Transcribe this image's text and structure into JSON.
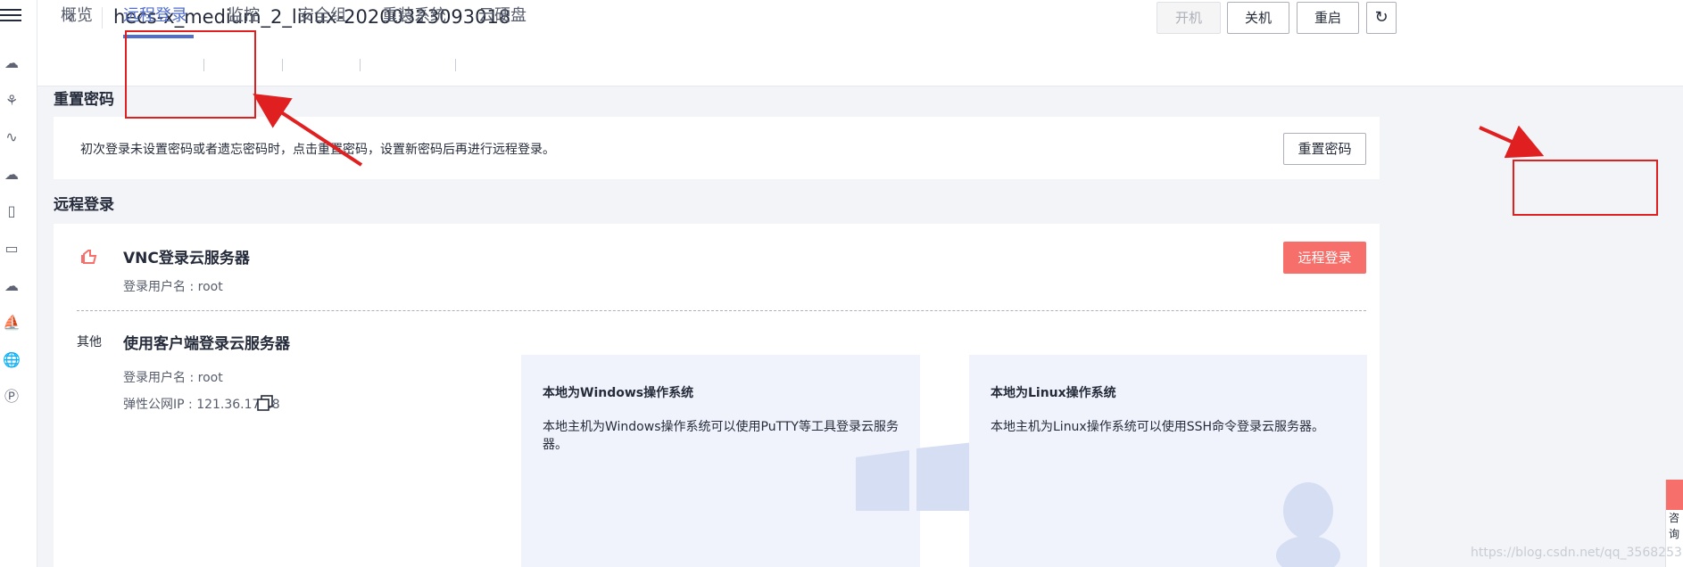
{
  "header": {
    "back_icon": "chevron-left-icon",
    "title": "hecs-x_medium_2_linux-20200323093018",
    "buttons": {
      "start": "开机",
      "shutdown": "关机",
      "restart": "重启",
      "refresh_icon": "refresh-icon"
    }
  },
  "tabs": [
    {
      "label": "概览"
    },
    {
      "label": "远程登录",
      "active": true
    },
    {
      "label": "监控"
    },
    {
      "label": "安全组"
    },
    {
      "label": "重装系统"
    },
    {
      "label": "云硬盘"
    }
  ],
  "reset_password": {
    "section_title": "重置密码",
    "hint": "初次登录未设置密码或者遗忘密码时，点击重置密码，设置新密码后再进行远程登录。",
    "button_label": "重置密码"
  },
  "remote_login": {
    "section_title": "远程登录",
    "vnc": {
      "title": "VNC登录云服务器",
      "username": "登录用户名 : root",
      "button_label": "远程登录"
    },
    "client": {
      "side_label": "其他",
      "title": "使用客户端登录云服务器",
      "username": "登录用户名 : root",
      "public_ip": "弹性公网IP : 121.36.173.8",
      "windows": {
        "title": "本地为Windows操作系统",
        "desc": "本地主机为Windows操作系统可以使用PuTTY等工具登录云服务器。"
      },
      "linux": {
        "title": "本地为Linux操作系统",
        "desc": "本地主机为Linux操作系统可以使用SSH命令登录云服务器。"
      }
    }
  },
  "float_chat": {
    "text": "咨询"
  },
  "watermark": "https://blog.csdn.net/qq_3568253",
  "colors": {
    "accent": "#526ecc",
    "primary_button": "#f66f6a",
    "annotation": "#e02020"
  }
}
